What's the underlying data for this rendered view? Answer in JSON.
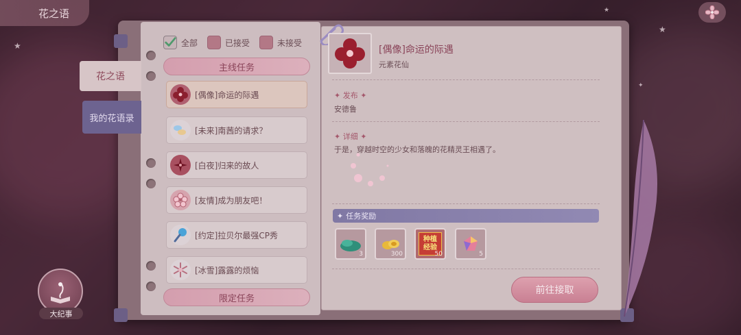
{
  "top_bar": {
    "title": "花之语",
    "close_icon": "flower-close-icon"
  },
  "side_tabs": [
    {
      "label": "花之语",
      "active": true
    },
    {
      "label": "我的花语录",
      "active": false
    }
  ],
  "filters": [
    {
      "label": "全部",
      "checked": true
    },
    {
      "label": "已接受",
      "checked": false
    },
    {
      "label": "未接受",
      "checked": false
    }
  ],
  "sections": {
    "main": "主线任务",
    "limited": "限定任务"
  },
  "quests": [
    {
      "label": "[偶像]命运的际遇",
      "icon": "red-flower-icon",
      "selected": true
    },
    {
      "label": "[未来]南茜的请求？",
      "icon": "butterfly-icon",
      "selected": false
    },
    {
      "label": "[白夜]归来的故人",
      "icon": "dark-red-flower-icon",
      "selected": false
    },
    {
      "label": "[友情]成为朋友吧！",
      "icon": "pink-blossom-icon",
      "selected": false
    },
    {
      "label": "[约定]拉贝尔最强CP秀",
      "icon": "microphone-icon",
      "selected": false
    },
    {
      "label": "[冰雪]露露的烦恼",
      "icon": "snowflake-icon",
      "selected": false
    }
  ],
  "detail": {
    "title": "[偶像]命运的际遇",
    "subtitle": "元素花仙",
    "publish_label": "发布",
    "publisher": "安德鲁",
    "detail_label": "详细",
    "description": "于是，穿越时空的少女和落魄的花精灵王相遇了。",
    "rewards_label": "任务奖励",
    "rewards": [
      {
        "icon": "green-slipper-icon",
        "count": "3"
      },
      {
        "icon": "gold-coins-icon",
        "count": "300"
      },
      {
        "icon": "planting-exp-icon",
        "count": "50",
        "text": "种植经验"
      },
      {
        "icon": "gem-icon",
        "count": "5"
      }
    ],
    "go_button": "前往接取"
  },
  "saga": {
    "label": "大纪事",
    "icon": "storybook-icon"
  },
  "colors": {
    "accent_pink": "#c98093",
    "title_pink": "#8a4459",
    "purple_tab": "#6d6390",
    "page": "#cdbdc0"
  }
}
